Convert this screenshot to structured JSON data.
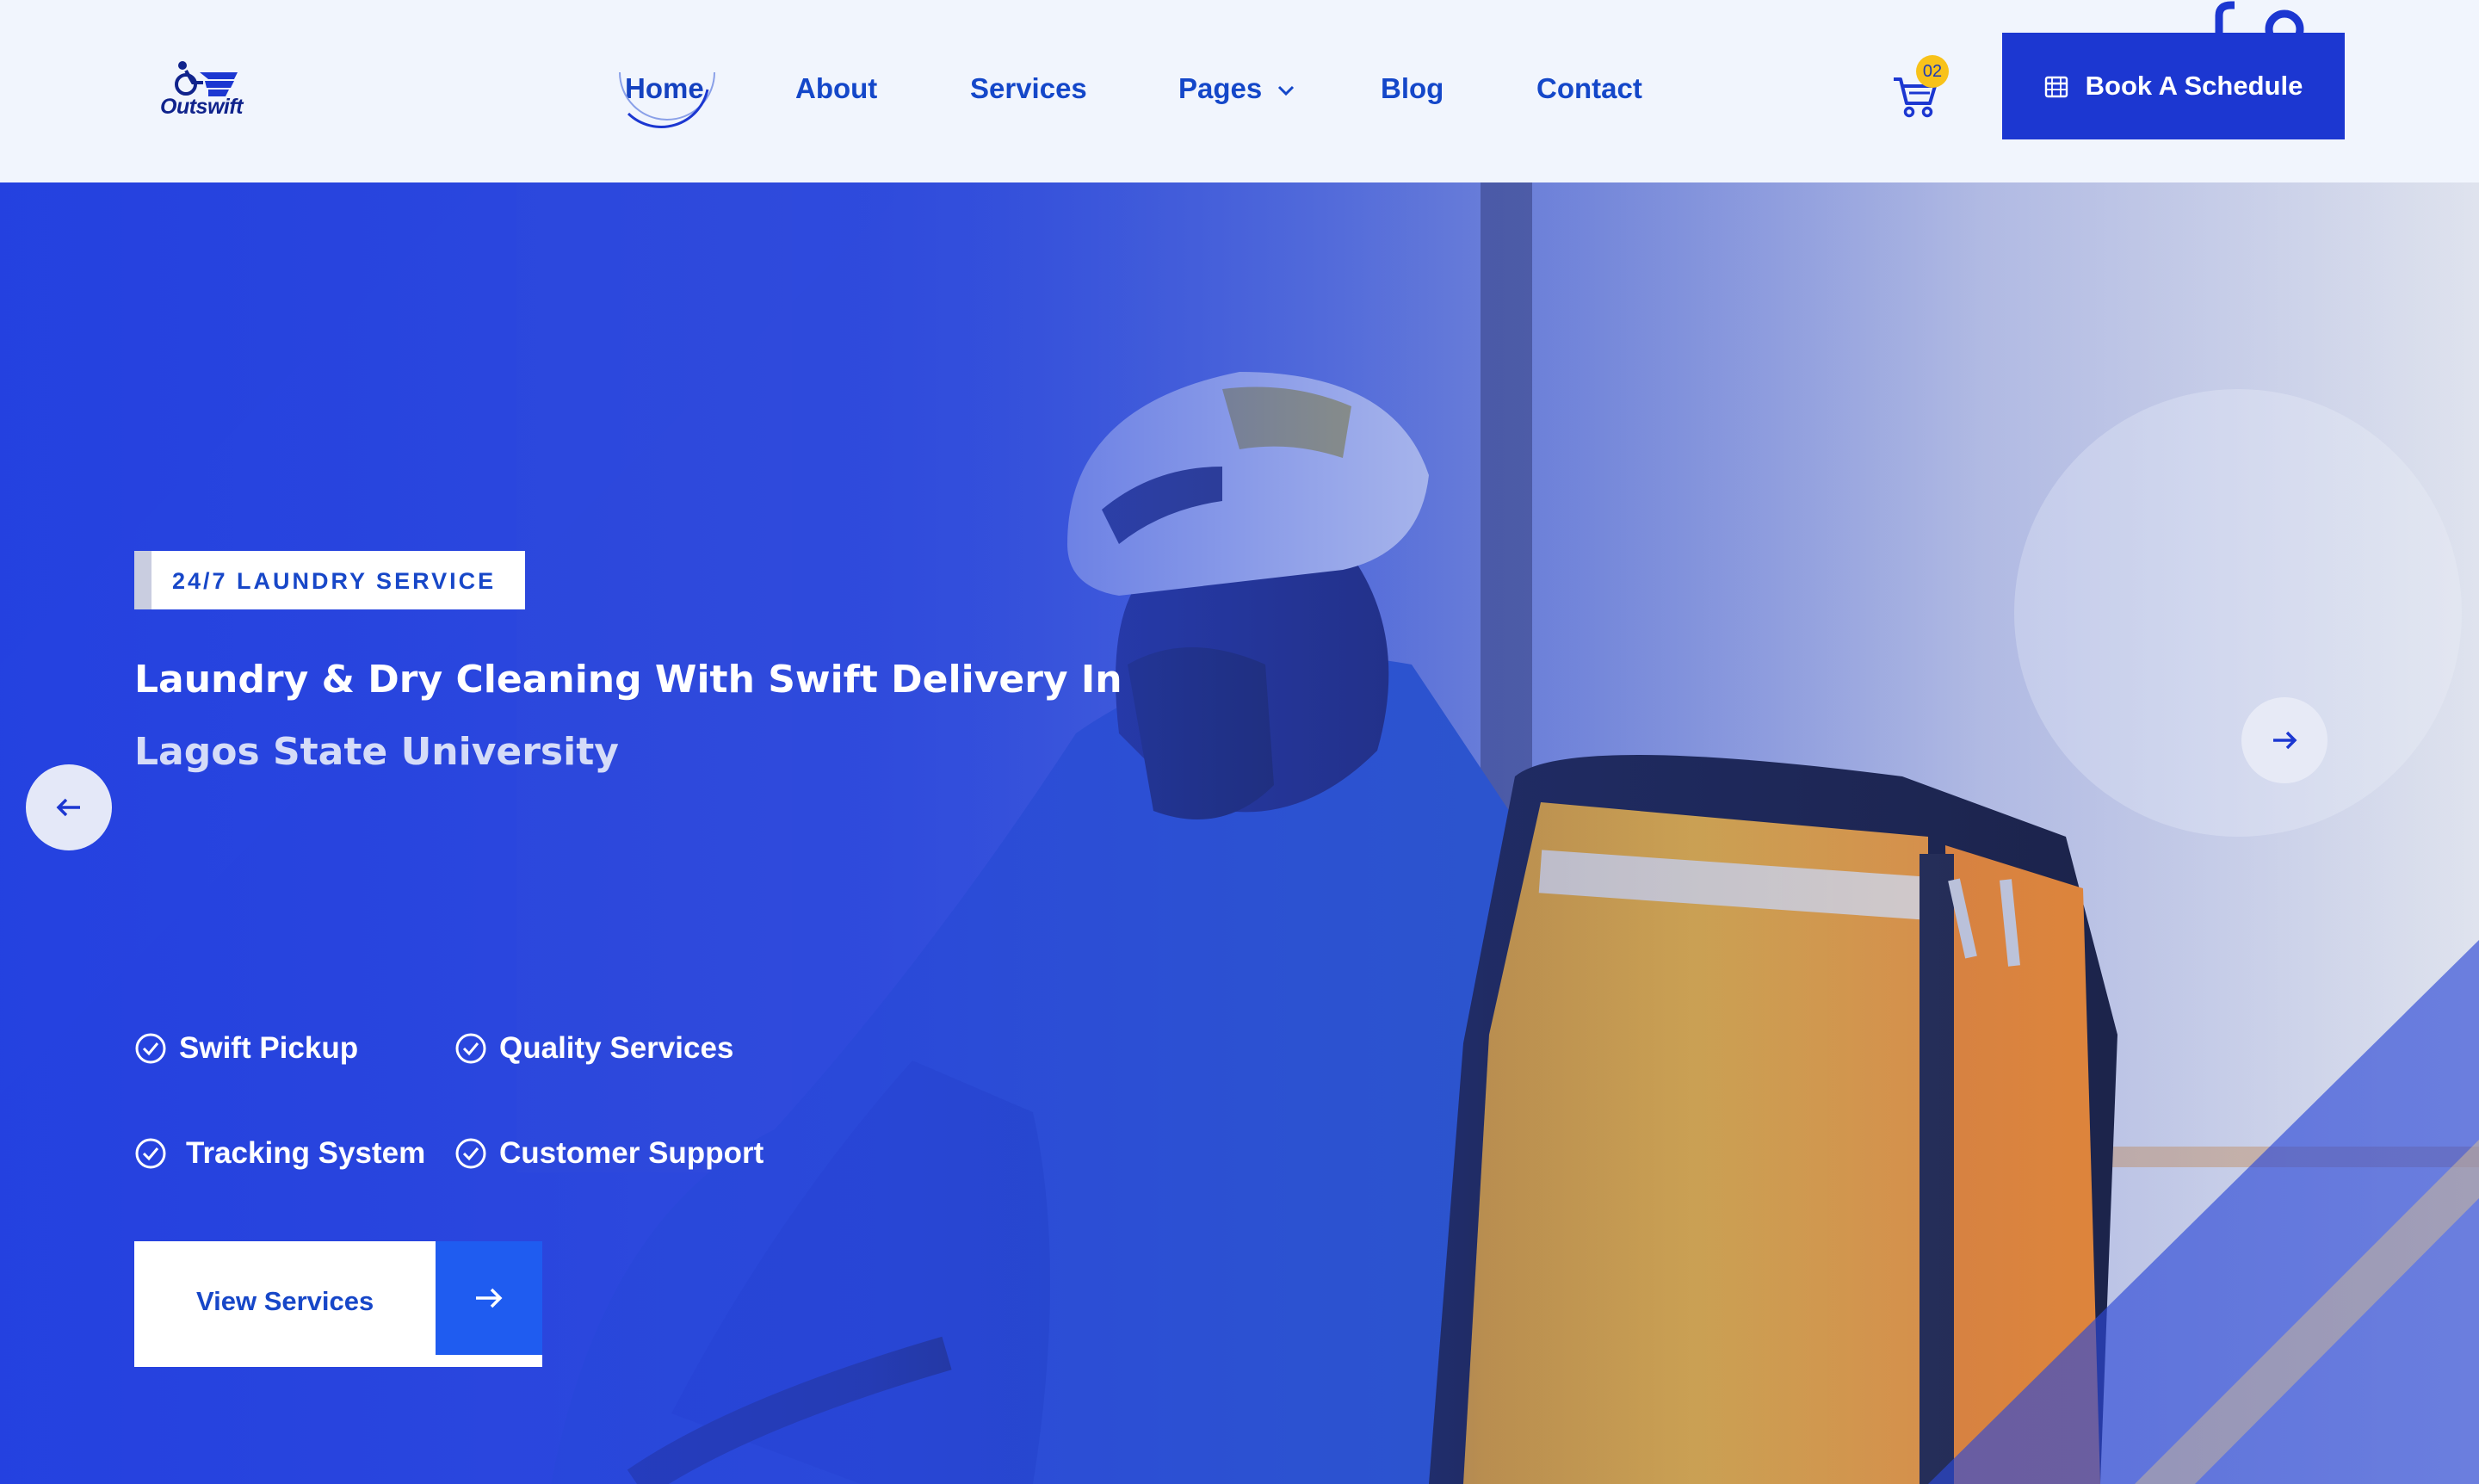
{
  "brand": {
    "name": "Outswift"
  },
  "nav": {
    "items": [
      {
        "label": "Home",
        "active": true
      },
      {
        "label": "About"
      },
      {
        "label": "Services"
      },
      {
        "label": "Pages",
        "has_dropdown": true
      },
      {
        "label": "Blog"
      },
      {
        "label": "Contact"
      }
    ]
  },
  "cart": {
    "count": "02",
    "icon": "cart-icon"
  },
  "book": {
    "label": "Book A Schedule",
    "icon": "calendar-icon"
  },
  "hero": {
    "tag": "24/7 LAUNDRY SERVICE",
    "headline_line1": "Laundry & Dry Cleaning With Swift Delivery In",
    "headline_line2": "Lagos State University",
    "features": [
      "Swift Pickup",
      "Quality Services",
      "Tracking System",
      "Customer Support"
    ],
    "cta_label": "View Services"
  },
  "colors": {
    "primary": "#1c37d1",
    "nav_text": "#1447c9",
    "badge": "#f8c21a",
    "hero_blue": "#2a46d9",
    "cta_arrow_bg": "#1f5cf0"
  }
}
